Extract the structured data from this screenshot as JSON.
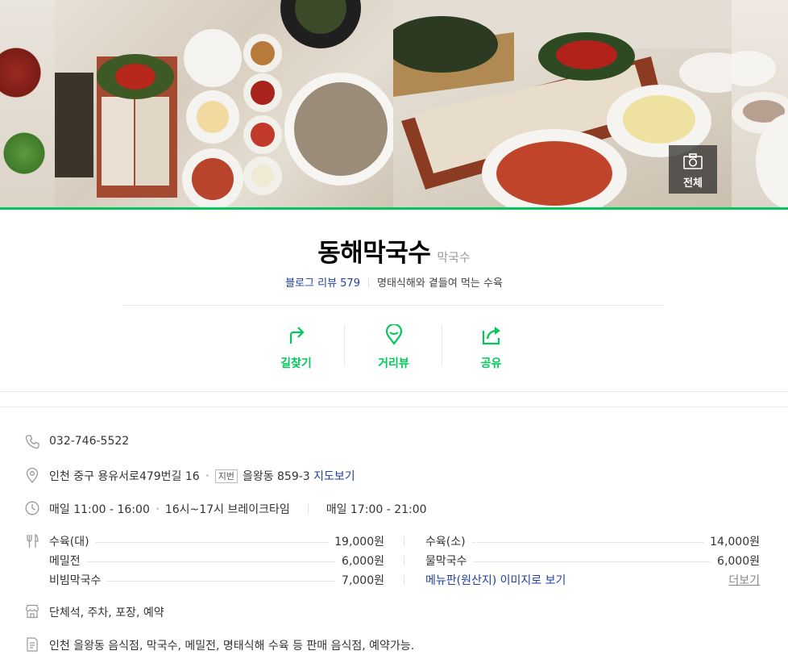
{
  "photos": {
    "all_label": "전체"
  },
  "place": {
    "name": "동해막국수",
    "category": "막국수",
    "blog_review_label": "블로그 리뷰 579",
    "description": "명태식해와 곁들여 먹는 수육"
  },
  "actions": [
    {
      "label": "길찾기",
      "icon": "directions-icon"
    },
    {
      "label": "거리뷰",
      "icon": "street-view-icon"
    },
    {
      "label": "공유",
      "icon": "share-icon"
    }
  ],
  "info": {
    "phone": "032-746-5522",
    "address": "인천 중구 용유서로479번길 16",
    "jibun_tag": "지번",
    "jibun_address": "을왕동 859-3",
    "map_link": "지도보기",
    "hours_1": "매일 11:00 - 16:00",
    "break_time": "16시~17시 브레이크타임",
    "hours_2": "매일 17:00 - 21:00",
    "facilities": "단체석, 주차, 포장, 예약",
    "intro": "인천 을왕동 음식점, 막국수, 메밀전, 명태식해 수육 등 판매 음식점, 예약가능."
  },
  "menu": {
    "items": [
      {
        "name": "수육(대)",
        "price": "19,000원"
      },
      {
        "name": "수육(소)",
        "price": "14,000원"
      },
      {
        "name": "메밀전",
        "price": "6,000원"
      },
      {
        "name": "물막국수",
        "price": "6,000원"
      },
      {
        "name": "비빔막국수",
        "price": "7,000원"
      }
    ],
    "menu_image_link": "메뉴판(원산지) 이미지로 보기",
    "more_label": "더보기"
  },
  "colors": {
    "accent": "#03c75a",
    "link": "#1f3fa8"
  }
}
